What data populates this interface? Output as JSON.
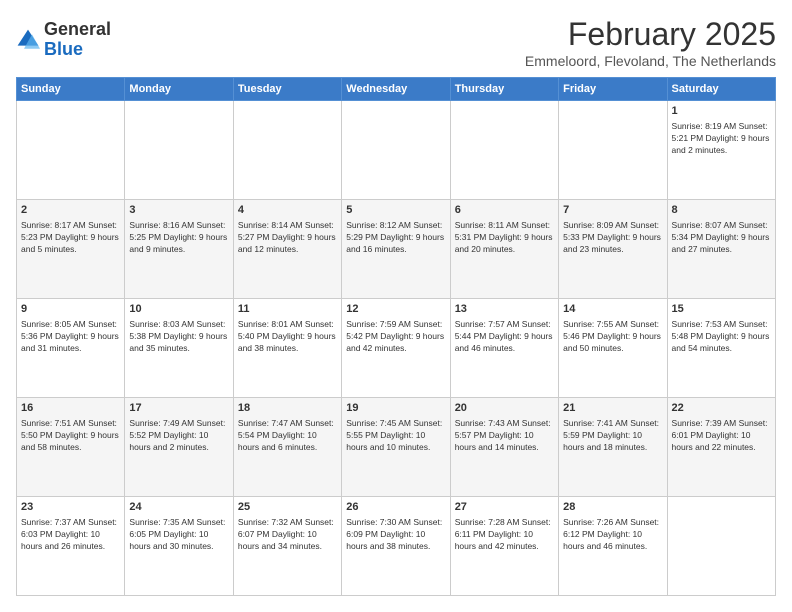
{
  "header": {
    "logo_general": "General",
    "logo_blue": "Blue",
    "title": "February 2025",
    "location": "Emmeloord, Flevoland, The Netherlands"
  },
  "days_of_week": [
    "Sunday",
    "Monday",
    "Tuesday",
    "Wednesday",
    "Thursday",
    "Friday",
    "Saturday"
  ],
  "weeks": [
    {
      "row_style": "normal-row",
      "days": [
        {
          "num": "",
          "info": ""
        },
        {
          "num": "",
          "info": ""
        },
        {
          "num": "",
          "info": ""
        },
        {
          "num": "",
          "info": ""
        },
        {
          "num": "",
          "info": ""
        },
        {
          "num": "",
          "info": ""
        },
        {
          "num": "1",
          "info": "Sunrise: 8:19 AM\nSunset: 5:21 PM\nDaylight: 9 hours and 2 minutes."
        }
      ]
    },
    {
      "row_style": "alt-row",
      "days": [
        {
          "num": "2",
          "info": "Sunrise: 8:17 AM\nSunset: 5:23 PM\nDaylight: 9 hours and 5 minutes."
        },
        {
          "num": "3",
          "info": "Sunrise: 8:16 AM\nSunset: 5:25 PM\nDaylight: 9 hours and 9 minutes."
        },
        {
          "num": "4",
          "info": "Sunrise: 8:14 AM\nSunset: 5:27 PM\nDaylight: 9 hours and 12 minutes."
        },
        {
          "num": "5",
          "info": "Sunrise: 8:12 AM\nSunset: 5:29 PM\nDaylight: 9 hours and 16 minutes."
        },
        {
          "num": "6",
          "info": "Sunrise: 8:11 AM\nSunset: 5:31 PM\nDaylight: 9 hours and 20 minutes."
        },
        {
          "num": "7",
          "info": "Sunrise: 8:09 AM\nSunset: 5:33 PM\nDaylight: 9 hours and 23 minutes."
        },
        {
          "num": "8",
          "info": "Sunrise: 8:07 AM\nSunset: 5:34 PM\nDaylight: 9 hours and 27 minutes."
        }
      ]
    },
    {
      "row_style": "normal-row",
      "days": [
        {
          "num": "9",
          "info": "Sunrise: 8:05 AM\nSunset: 5:36 PM\nDaylight: 9 hours and 31 minutes."
        },
        {
          "num": "10",
          "info": "Sunrise: 8:03 AM\nSunset: 5:38 PM\nDaylight: 9 hours and 35 minutes."
        },
        {
          "num": "11",
          "info": "Sunrise: 8:01 AM\nSunset: 5:40 PM\nDaylight: 9 hours and 38 minutes."
        },
        {
          "num": "12",
          "info": "Sunrise: 7:59 AM\nSunset: 5:42 PM\nDaylight: 9 hours and 42 minutes."
        },
        {
          "num": "13",
          "info": "Sunrise: 7:57 AM\nSunset: 5:44 PM\nDaylight: 9 hours and 46 minutes."
        },
        {
          "num": "14",
          "info": "Sunrise: 7:55 AM\nSunset: 5:46 PM\nDaylight: 9 hours and 50 minutes."
        },
        {
          "num": "15",
          "info": "Sunrise: 7:53 AM\nSunset: 5:48 PM\nDaylight: 9 hours and 54 minutes."
        }
      ]
    },
    {
      "row_style": "alt-row",
      "days": [
        {
          "num": "16",
          "info": "Sunrise: 7:51 AM\nSunset: 5:50 PM\nDaylight: 9 hours and 58 minutes."
        },
        {
          "num": "17",
          "info": "Sunrise: 7:49 AM\nSunset: 5:52 PM\nDaylight: 10 hours and 2 minutes."
        },
        {
          "num": "18",
          "info": "Sunrise: 7:47 AM\nSunset: 5:54 PM\nDaylight: 10 hours and 6 minutes."
        },
        {
          "num": "19",
          "info": "Sunrise: 7:45 AM\nSunset: 5:55 PM\nDaylight: 10 hours and 10 minutes."
        },
        {
          "num": "20",
          "info": "Sunrise: 7:43 AM\nSunset: 5:57 PM\nDaylight: 10 hours and 14 minutes."
        },
        {
          "num": "21",
          "info": "Sunrise: 7:41 AM\nSunset: 5:59 PM\nDaylight: 10 hours and 18 minutes."
        },
        {
          "num": "22",
          "info": "Sunrise: 7:39 AM\nSunset: 6:01 PM\nDaylight: 10 hours and 22 minutes."
        }
      ]
    },
    {
      "row_style": "normal-row",
      "days": [
        {
          "num": "23",
          "info": "Sunrise: 7:37 AM\nSunset: 6:03 PM\nDaylight: 10 hours and 26 minutes."
        },
        {
          "num": "24",
          "info": "Sunrise: 7:35 AM\nSunset: 6:05 PM\nDaylight: 10 hours and 30 minutes."
        },
        {
          "num": "25",
          "info": "Sunrise: 7:32 AM\nSunset: 6:07 PM\nDaylight: 10 hours and 34 minutes."
        },
        {
          "num": "26",
          "info": "Sunrise: 7:30 AM\nSunset: 6:09 PM\nDaylight: 10 hours and 38 minutes."
        },
        {
          "num": "27",
          "info": "Sunrise: 7:28 AM\nSunset: 6:11 PM\nDaylight: 10 hours and 42 minutes."
        },
        {
          "num": "28",
          "info": "Sunrise: 7:26 AM\nSunset: 6:12 PM\nDaylight: 10 hours and 46 minutes."
        },
        {
          "num": "",
          "info": ""
        }
      ]
    }
  ]
}
